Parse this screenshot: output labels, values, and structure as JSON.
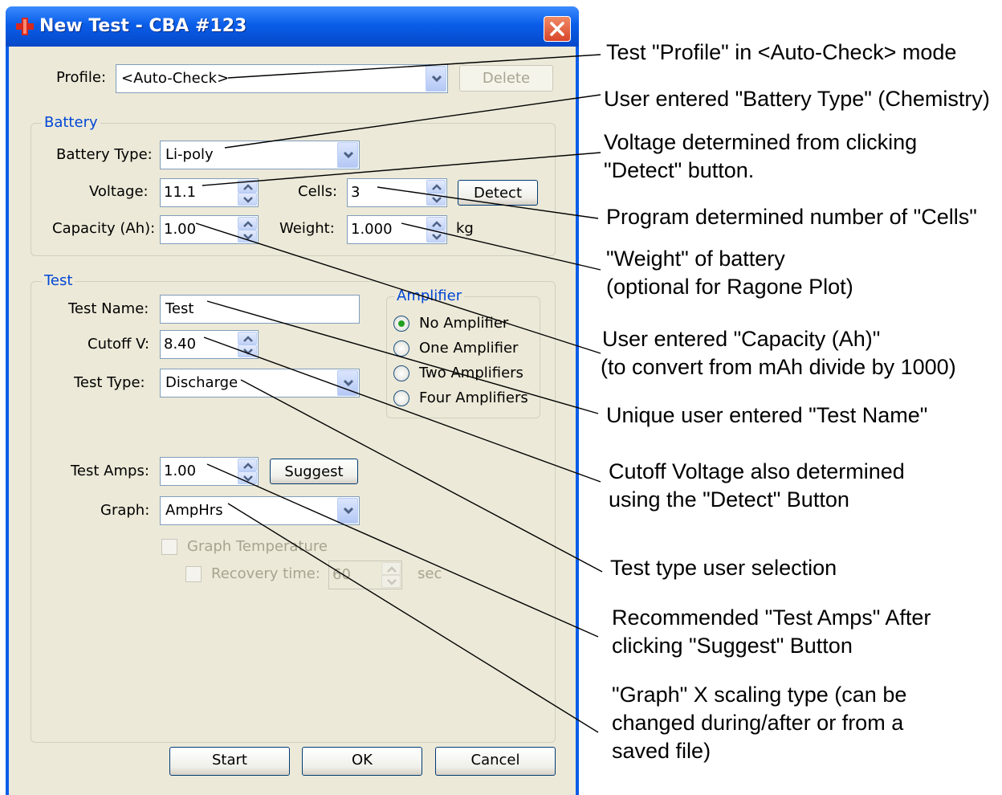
{
  "window": {
    "title": "New Test - CBA #123"
  },
  "profile": {
    "label": "Profile:",
    "value": "<Auto-Check>",
    "delete_label": "Delete"
  },
  "battery": {
    "group_title": "Battery",
    "type_label": "Battery Type:",
    "type_value": "Li-poly",
    "voltage_label": "Voltage:",
    "voltage_value": "11.1",
    "cells_label": "Cells:",
    "cells_value": "3",
    "detect_label": "Detect",
    "capacity_label": "Capacity (Ah):",
    "capacity_value": "1.00",
    "weight_label": "Weight:",
    "weight_value": "1.000",
    "weight_unit": "kg"
  },
  "test": {
    "group_title": "Test",
    "name_label": "Test Name:",
    "name_value": "Test",
    "cutoff_label": "Cutoff V:",
    "cutoff_value": "8.40",
    "type_label": "Test Type:",
    "type_value": "Discharge",
    "amps_label": "Test Amps:",
    "amps_value": "1.00",
    "suggest_label": "Suggest",
    "graph_label": "Graph:",
    "graph_value": "AmpHrs",
    "graph_temp_label": "Graph Temperature",
    "recovery_label": "Recovery time:",
    "recovery_value": "60",
    "recovery_unit": "sec"
  },
  "amplifier": {
    "group_title": "Amplifier",
    "options": [
      "No Amplifier",
      "One Amplifier",
      "Two Amplifiers",
      "Four Amplifiers"
    ],
    "selected": 0
  },
  "buttons": {
    "start": "Start",
    "ok": "OK",
    "cancel": "Cancel"
  },
  "annotations": [
    "Test \"Profile\" in <Auto-Check> mode",
    "User entered \"Battery Type\" (Chemistry)",
    "Voltage determined from clicking",
    "\"Detect\" button.",
    "Program determined number of \"Cells\"",
    "\"Weight\" of battery",
    "(optional for Ragone Plot)",
    "User entered \"Capacity (Ah)\"",
    "(to convert from mAh divide by 1000)",
    "Unique user entered \"Test Name\"",
    "Cutoff Voltage also determined",
    "using the \"Detect\" Button",
    "Test type user selection",
    "Recommended \"Test Amps\" After",
    "clicking \"Suggest\" Button",
    "\"Graph\" X scaling type (can be",
    "changed during/after or from a",
    "saved file)"
  ],
  "colors": {
    "titlebar": "#0a5de8",
    "client": "#ece9d8",
    "group_title": "#0046d5"
  }
}
